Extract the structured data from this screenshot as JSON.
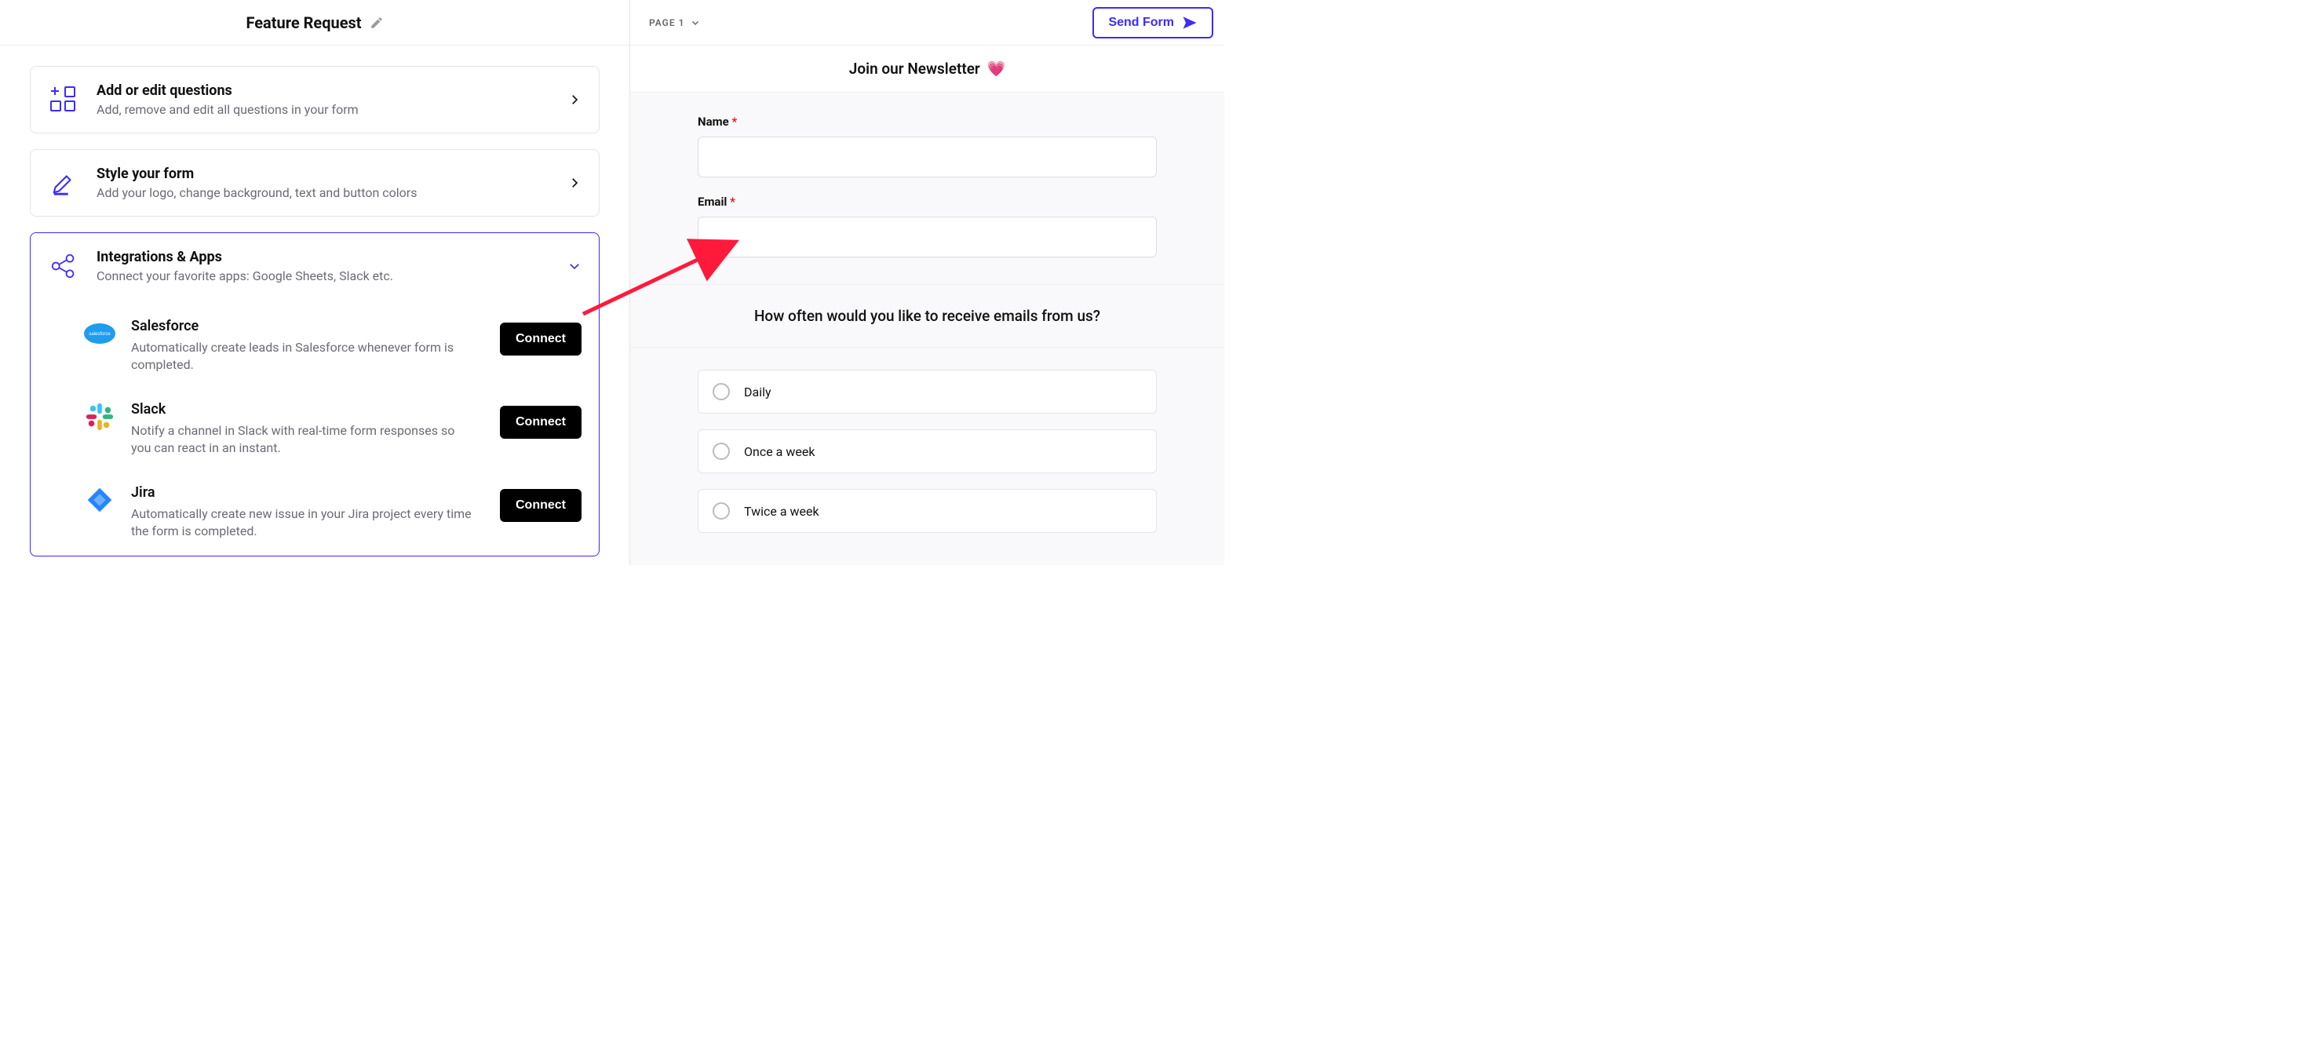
{
  "left": {
    "title": "Feature Request",
    "cards": {
      "questions": {
        "title": "Add or edit questions",
        "sub": "Add, remove and edit all questions in your form"
      },
      "style": {
        "title": "Style your form",
        "sub": "Add your logo, change background, text and button colors"
      },
      "integrations": {
        "title": "Integrations & Apps",
        "sub": "Connect your favorite apps: Google Sheets, Slack etc.",
        "items": [
          {
            "name": "Salesforce",
            "desc": "Automatically create leads in Salesforce whenever form is completed.",
            "btn": "Connect"
          },
          {
            "name": "Slack",
            "desc": "Notify a channel in Slack with real-time form responses so you can react in an instant.",
            "btn": "Connect"
          },
          {
            "name": "Jira",
            "desc": "Automatically create new issue in your Jira project every time the form is completed.",
            "btn": "Connect"
          }
        ]
      }
    }
  },
  "right": {
    "page_label": "PAGE 1",
    "send_label": "Send Form",
    "form_title": "Join our Newsletter",
    "form_emoji": "💗",
    "fields": {
      "name": {
        "label": "Name",
        "required": "*"
      },
      "email": {
        "label": "Email",
        "required": "*"
      }
    },
    "question": "How often would you like to receive emails from us?",
    "options": [
      "Daily",
      "Once a week",
      "Twice a week"
    ]
  }
}
